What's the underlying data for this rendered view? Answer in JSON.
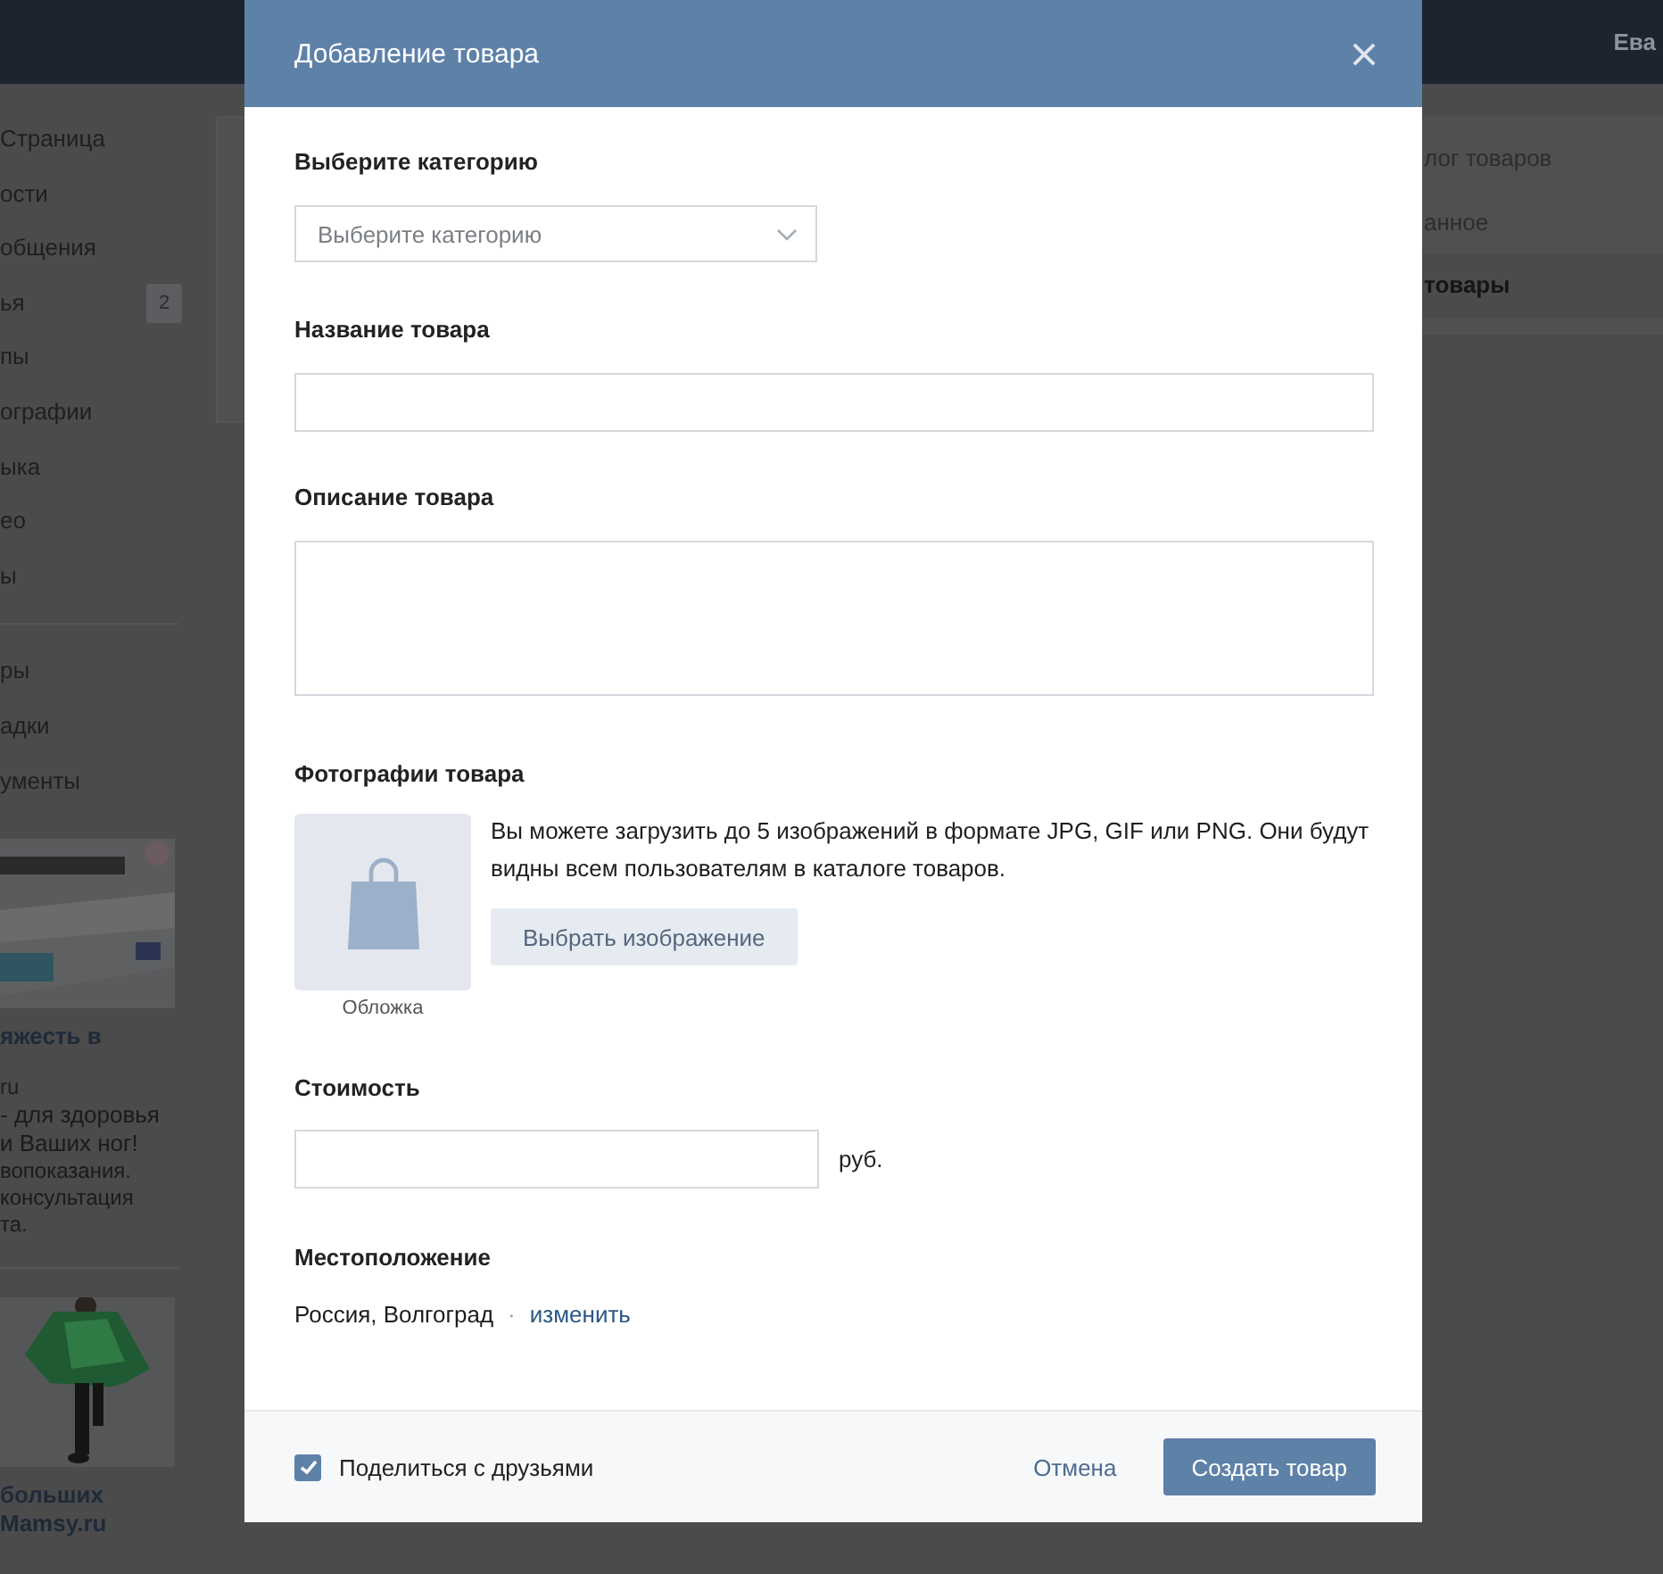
{
  "top_bar": {
    "user_name": "Ева"
  },
  "sidebar": {
    "items": [
      {
        "label": "Страница"
      },
      {
        "label": "ости"
      },
      {
        "label": "общения"
      },
      {
        "label": "ья",
        "badge": "2"
      },
      {
        "label": "пы"
      },
      {
        "label": "ографии"
      },
      {
        "label": "ыка"
      },
      {
        "label": "ео"
      },
      {
        "label": "ы"
      }
    ],
    "extra_items": [
      {
        "label": "ры"
      },
      {
        "label": "адки"
      },
      {
        "label": "ументы"
      }
    ]
  },
  "ads": [
    {
      "kind": "picture",
      "title_lines": [
        "яжесть в"
      ],
      "domain": "ru",
      "headline_lines": [
        "- для здоровья",
        "и Ваших ног!"
      ],
      "note_lines": [
        "вопоказания.",
        "консультация",
        "та."
      ]
    },
    {
      "kind": "picture",
      "title_lines": [
        "больших",
        "Mamsy.ru"
      ]
    }
  ],
  "right_menu": {
    "items": [
      {
        "label": "лог товаров",
        "selected": false
      },
      {
        "label": "анное",
        "selected": false
      },
      {
        "label": "товары",
        "selected": true
      }
    ]
  },
  "modal": {
    "title": "Добавление товара",
    "category": {
      "label": "Выберите категорию",
      "placeholder": "Выберите категорию"
    },
    "name": {
      "label": "Название товара"
    },
    "description": {
      "label": "Описание товара"
    },
    "photos": {
      "label": "Фотографии товара",
      "cover_caption": "Обложка",
      "hint": "Вы можете загрузить до 5 изображений в формате JPG, GIF или PNG. Они будут видны всем пользователям в каталоге товаров.",
      "button": "Выбрать изображение"
    },
    "price": {
      "label": "Стоимость",
      "unit": "руб."
    },
    "location": {
      "label": "Местоположение",
      "value": "Россия, Волгоград",
      "separator": "·",
      "change_link": "изменить"
    },
    "footer": {
      "share": {
        "label": "Поделиться с друзьями",
        "checked": true
      },
      "cancel": "Отмена",
      "submit": "Создать товар"
    }
  }
}
